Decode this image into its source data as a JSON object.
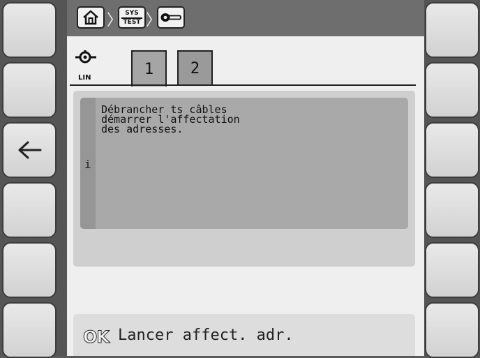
{
  "breadcrumb": {
    "sys_line1": "SYS",
    "sys_line2": "TEST",
    "icons": [
      "home-icon",
      "sys-test-icon",
      "key-icon"
    ]
  },
  "connection": {
    "label": "LIN",
    "icon": "lin-connector-icon"
  },
  "tabs": [
    {
      "label": "1",
      "selected": true
    },
    {
      "label": "2",
      "selected": false
    }
  ],
  "message": {
    "info_marker": "i",
    "text": "Débrancher ts câbles\ndémarrer l'affectation\ndes adresses."
  },
  "status": {
    "ok_label": "OK",
    "action_text": "Lancer affect. adr."
  },
  "softkeys": {
    "left_3_icon": "back-arrow-icon"
  },
  "colors": {
    "frame": "#555555",
    "topbar": "#6e6e6e",
    "screen": "#efefef",
    "message_box": "#a9a9a9",
    "softkey": "#dcdcdc"
  }
}
